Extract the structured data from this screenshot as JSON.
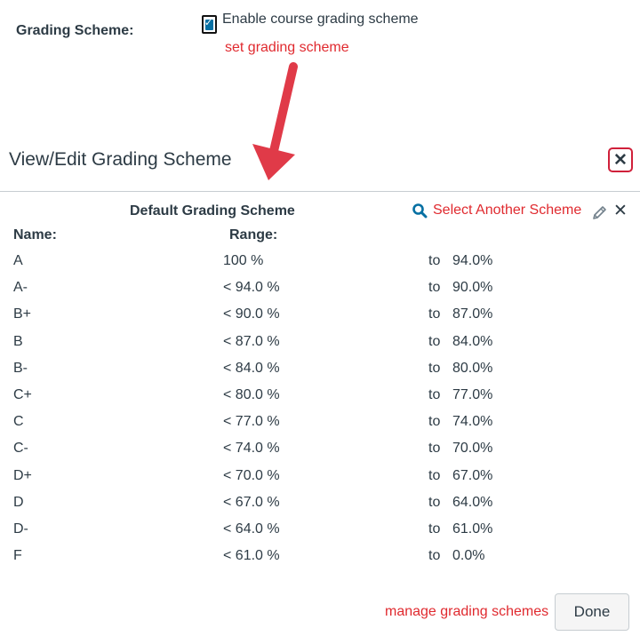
{
  "settings": {
    "label": "Grading Scheme:",
    "enable_checked": true,
    "enable_label": "Enable course grading scheme"
  },
  "annotation": {
    "text": "set grading scheme",
    "color": "#e02a2f"
  },
  "dialog": {
    "title": "View/Edit Grading Scheme",
    "close_icon": "close-icon",
    "scheme_name": "Default Grading Scheme",
    "select_another": "Select Another Scheme",
    "col_name": "Name:",
    "col_range": "Range:",
    "rows": [
      {
        "name": "A",
        "high": "100 %",
        "to": "to",
        "low": "94.0%"
      },
      {
        "name": "A-",
        "high": "< 94.0 %",
        "to": "to",
        "low": "90.0%"
      },
      {
        "name": "B+",
        "high": "< 90.0 %",
        "to": "to",
        "low": "87.0%"
      },
      {
        "name": "B",
        "high": "< 87.0 %",
        "to": "to",
        "low": "84.0%"
      },
      {
        "name": "B-",
        "high": "< 84.0 %",
        "to": "to",
        "low": "80.0%"
      },
      {
        "name": "C+",
        "high": "< 80.0 %",
        "to": "to",
        "low": "77.0%"
      },
      {
        "name": "C",
        "high": "< 77.0 %",
        "to": "to",
        "low": "74.0%"
      },
      {
        "name": "C-",
        "high": "< 74.0 %",
        "to": "to",
        "low": "70.0%"
      },
      {
        "name": "D+",
        "high": "< 70.0 %",
        "to": "to",
        "low": "67.0%"
      },
      {
        "name": "D",
        "high": "< 67.0 %",
        "to": "to",
        "low": "64.0%"
      },
      {
        "name": "D-",
        "high": "< 64.0 %",
        "to": "to",
        "low": "61.0%"
      },
      {
        "name": "F",
        "high": "< 61.0 %",
        "to": "to",
        "low": "0.0%"
      }
    ],
    "manage_link": "manage grading schemes",
    "done_label": "Done"
  },
  "colors": {
    "link": "#e02a2f",
    "text": "#2d3b45",
    "accent": "#0770a3"
  }
}
